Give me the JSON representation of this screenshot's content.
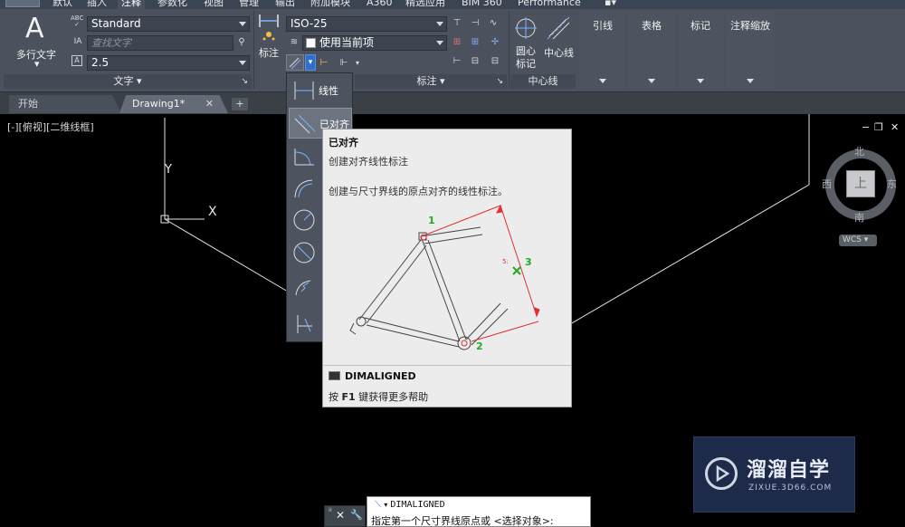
{
  "ribbon_tabs": [
    "默认",
    "插入",
    "注释",
    "参数化",
    "视图",
    "管理",
    "输出",
    "附加模块",
    "A360",
    "精选应用",
    "BIM 360",
    "Performance"
  ],
  "active_tab": "注释",
  "text_panel": {
    "big_button_glyph": "A",
    "big_button_label": "多行文字",
    "style_combo": "Standard",
    "find_placeholder": "查找文字",
    "height_combo": "2.5",
    "title": "文字"
  },
  "dim_panel": {
    "big_button_label": "标注",
    "dimstyle_combo": "ISO-25",
    "layer_combo": "使用当前项",
    "title": "标注"
  },
  "centerline_panel": {
    "center_mark_label": "圆心\n标记",
    "centerline_label": "中心线",
    "title": "中心线"
  },
  "dropdown_panels": [
    "引线",
    "表格",
    "标记",
    "注释缩放"
  ],
  "doc_tabs": {
    "start": "开始",
    "drawing": "Drawing1*",
    "close": "✕",
    "new": "+"
  },
  "viewport_label": "[-][俯视][二维线框]",
  "window_controls": [
    "−",
    "❐",
    "✕"
  ],
  "axes": {
    "y": "Y",
    "x": "X"
  },
  "viewcube": {
    "north": "北",
    "south": "南",
    "west": "西",
    "east": "东",
    "face": "上",
    "wcs": "WCS"
  },
  "flyout_items": [
    {
      "label": "线性",
      "icon": "linear-dim-icon"
    },
    {
      "label": "已对齐",
      "icon": "aligned-dim-icon"
    },
    {
      "label": "角度",
      "icon": "angular-dim-icon"
    },
    {
      "label": "弧长",
      "icon": "arc-length-icon"
    },
    {
      "label": "半径",
      "icon": "radius-icon"
    },
    {
      "label": "直径",
      "icon": "diameter-icon"
    },
    {
      "label": "折弯",
      "icon": "jogged-icon"
    },
    {
      "label": "坐标",
      "icon": "ordinate-icon"
    }
  ],
  "tooltip": {
    "title": "已对齐",
    "subtitle": "创建对齐线性标注",
    "description": "创建与尺寸界线的原点对齐的线性标注。",
    "markers": [
      "1",
      "2",
      "3"
    ],
    "command": "DIMALIGNED",
    "help_prefix": "按 ",
    "help_key": "F1",
    "help_suffix": " 键获得更多帮助"
  },
  "command_line": {
    "grip_close": "✕",
    "grip_wrench": "🔧",
    "command": "DIMALIGNED",
    "prompt": "指定第一个尺寸界线原点或 <选择对象>:"
  },
  "watermark": {
    "title": "溜溜自学",
    "url": "ZIXUE.3D66.COM"
  },
  "colors": {
    "ribbon": "#4b525d",
    "canvas": "#000000",
    "tooltip_bg": "#ececec",
    "dim_red": "#e03030",
    "marker_green": "#22aa22"
  }
}
